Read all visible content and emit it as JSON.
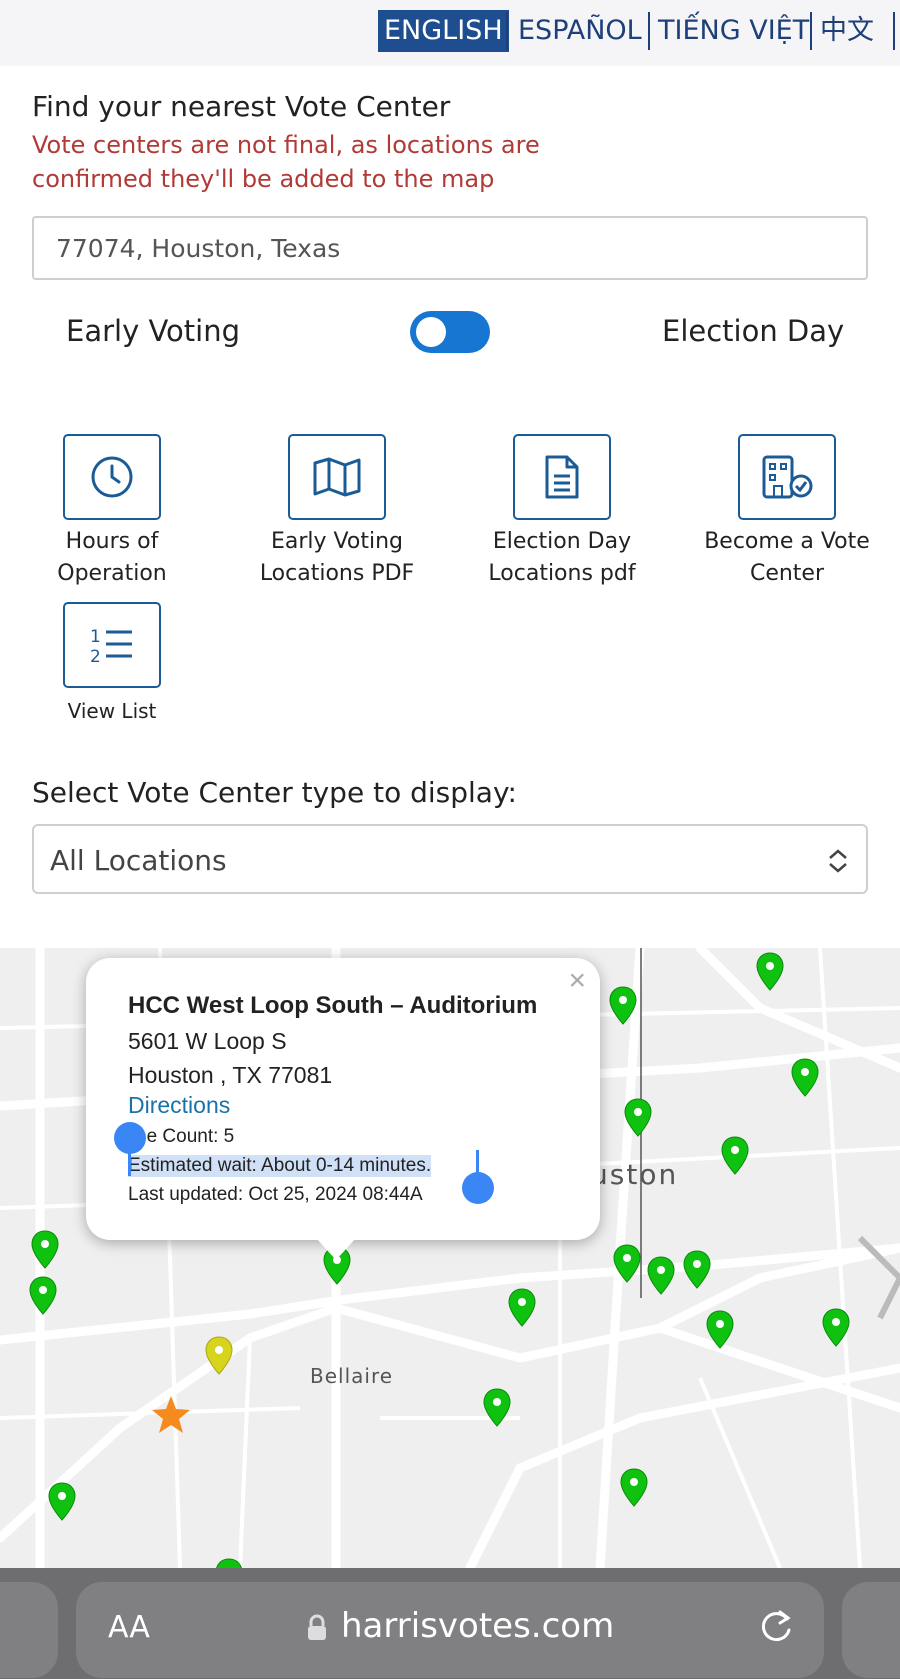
{
  "languages": [
    {
      "label": "ENGLISH",
      "active": true
    },
    {
      "label": "ESPAÑOL",
      "active": false
    },
    {
      "label": "TIẾNG VIỆT",
      "active": false
    },
    {
      "label": "中文",
      "active": false
    }
  ],
  "finder": {
    "title": "Find your nearest Vote Center",
    "notice": "Vote centers are not final, as locations are confirmed they'll be added to the map",
    "search_value": "77074, Houston, Texas"
  },
  "toggle": {
    "left_label": "Early Voting",
    "right_label": "Election Day",
    "state": "early-voting"
  },
  "quick_links": [
    {
      "label": "Hours of Operation",
      "icon": "clock-icon"
    },
    {
      "label": "Early Voting Locations PDF",
      "icon": "map-icon"
    },
    {
      "label": "Election Day Locations pdf",
      "icon": "document-icon"
    },
    {
      "label": "Become a Vote Center",
      "icon": "building-check-icon"
    },
    {
      "label": "View List",
      "icon": "numbered-list-icon"
    }
  ],
  "filter": {
    "title": "Select Vote Center type to display:",
    "selected": "All Locations"
  },
  "map": {
    "city_label": "uston",
    "suburb_label": "Bellaire",
    "pin_colors": {
      "green": "#10c210",
      "yellow": "#d6d41c",
      "orange": "#f58a1f"
    }
  },
  "popup": {
    "close": "×",
    "name": "HCC West Loop South – Auditorium",
    "address1": "5601 W Loop S",
    "address2": "Houston , TX 77081",
    "directions": "Directions",
    "line_count": "ne Count: 5",
    "wait": "Estimated wait: About 0-14 minutes.",
    "updated": "Last updated: Oct 25, 2024 08:44A"
  },
  "browser": {
    "text_size": "AA",
    "url": "harrisvotes.com"
  }
}
